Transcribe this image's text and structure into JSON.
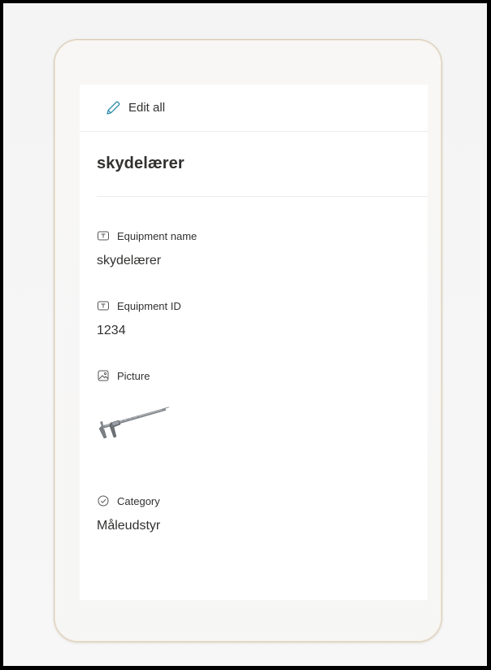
{
  "command_bar": {
    "edit_all_label": "Edit all"
  },
  "record": {
    "title": "skydelærer"
  },
  "fields": [
    {
      "label": "Equipment name",
      "value": "skydelærer",
      "icon": "text-field-icon"
    },
    {
      "label": "Equipment ID",
      "value": "1234",
      "icon": "text-field-icon"
    },
    {
      "label": "Picture",
      "value": "",
      "icon": "image-field-icon"
    },
    {
      "label": "Category",
      "value": "Måleudstyr",
      "icon": "choice-field-icon"
    }
  ],
  "colors": {
    "accent": "#2b88a8",
    "text": "#323130",
    "divider": "#ececec"
  }
}
